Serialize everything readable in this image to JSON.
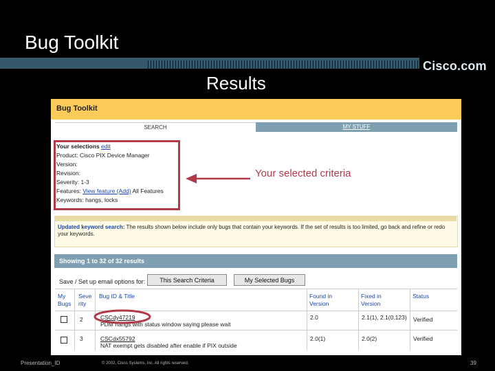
{
  "slide": {
    "title": "Bug Toolkit",
    "subtitle": "Results",
    "brand": "Cisco.com",
    "annotation": "Your selected criteria",
    "footer_left": "Presentation_ID",
    "footer_center": "© 2002, Cisco Systems, Inc. All rights reserved.",
    "page_number": "39"
  },
  "app": {
    "title": "Bug Toolkit",
    "tabs": [
      {
        "label": "SEARCH"
      },
      {
        "label": "MY STUFF"
      }
    ],
    "selections": {
      "heading": "Your selections",
      "edit_link": "edit",
      "rows": [
        {
          "label": "Product:",
          "value": "Cisco PIX Device Manager"
        },
        {
          "label": "Version:",
          "value": ""
        },
        {
          "label": "Revision:",
          "value": ""
        },
        {
          "label": "Severity:",
          "value": "1-3"
        },
        {
          "label": "Features:",
          "link": "View feature (Add)",
          "value": "All Features"
        },
        {
          "label": "Keywords:",
          "value": "hangs, locks"
        }
      ]
    },
    "notice": {
      "heading": "Updated keyword search:",
      "text": "The results shown below include only bugs that contain your keywords. If the set of results is too limited, go back and refine or redo your keywords."
    },
    "results_summary": "Showing 1 to 32 of 32 results",
    "save_label": "Save / Set up email options for:",
    "buttons": {
      "this_search": "This Search Criteria",
      "my_selected": "My Selected Bugs"
    },
    "table": {
      "headers": [
        "My Bugs",
        "Seve rity",
        "Bug ID & Title",
        "Found in Version",
        "Fixed in Version",
        "Status"
      ],
      "rows": [
        {
          "severity": "2",
          "bug_id": "CSCdy47219",
          "title": "PDM hangs with status window saying please wait",
          "found": "2.0",
          "fixed": "2.1(1), 2.1(0.123)",
          "status": "Verified"
        },
        {
          "severity": "3",
          "bug_id": "CSCdx55792",
          "title": "NAT exempt gets disabled after enable if PIX outside",
          "found": "2.0(1)",
          "fixed": "2.0(2)",
          "status": "Verified"
        }
      ]
    }
  },
  "colors": {
    "accent_yellow": "#fbcc5a",
    "annotation_red": "#b23a48",
    "steel_blue": "#7fa0b0"
  }
}
